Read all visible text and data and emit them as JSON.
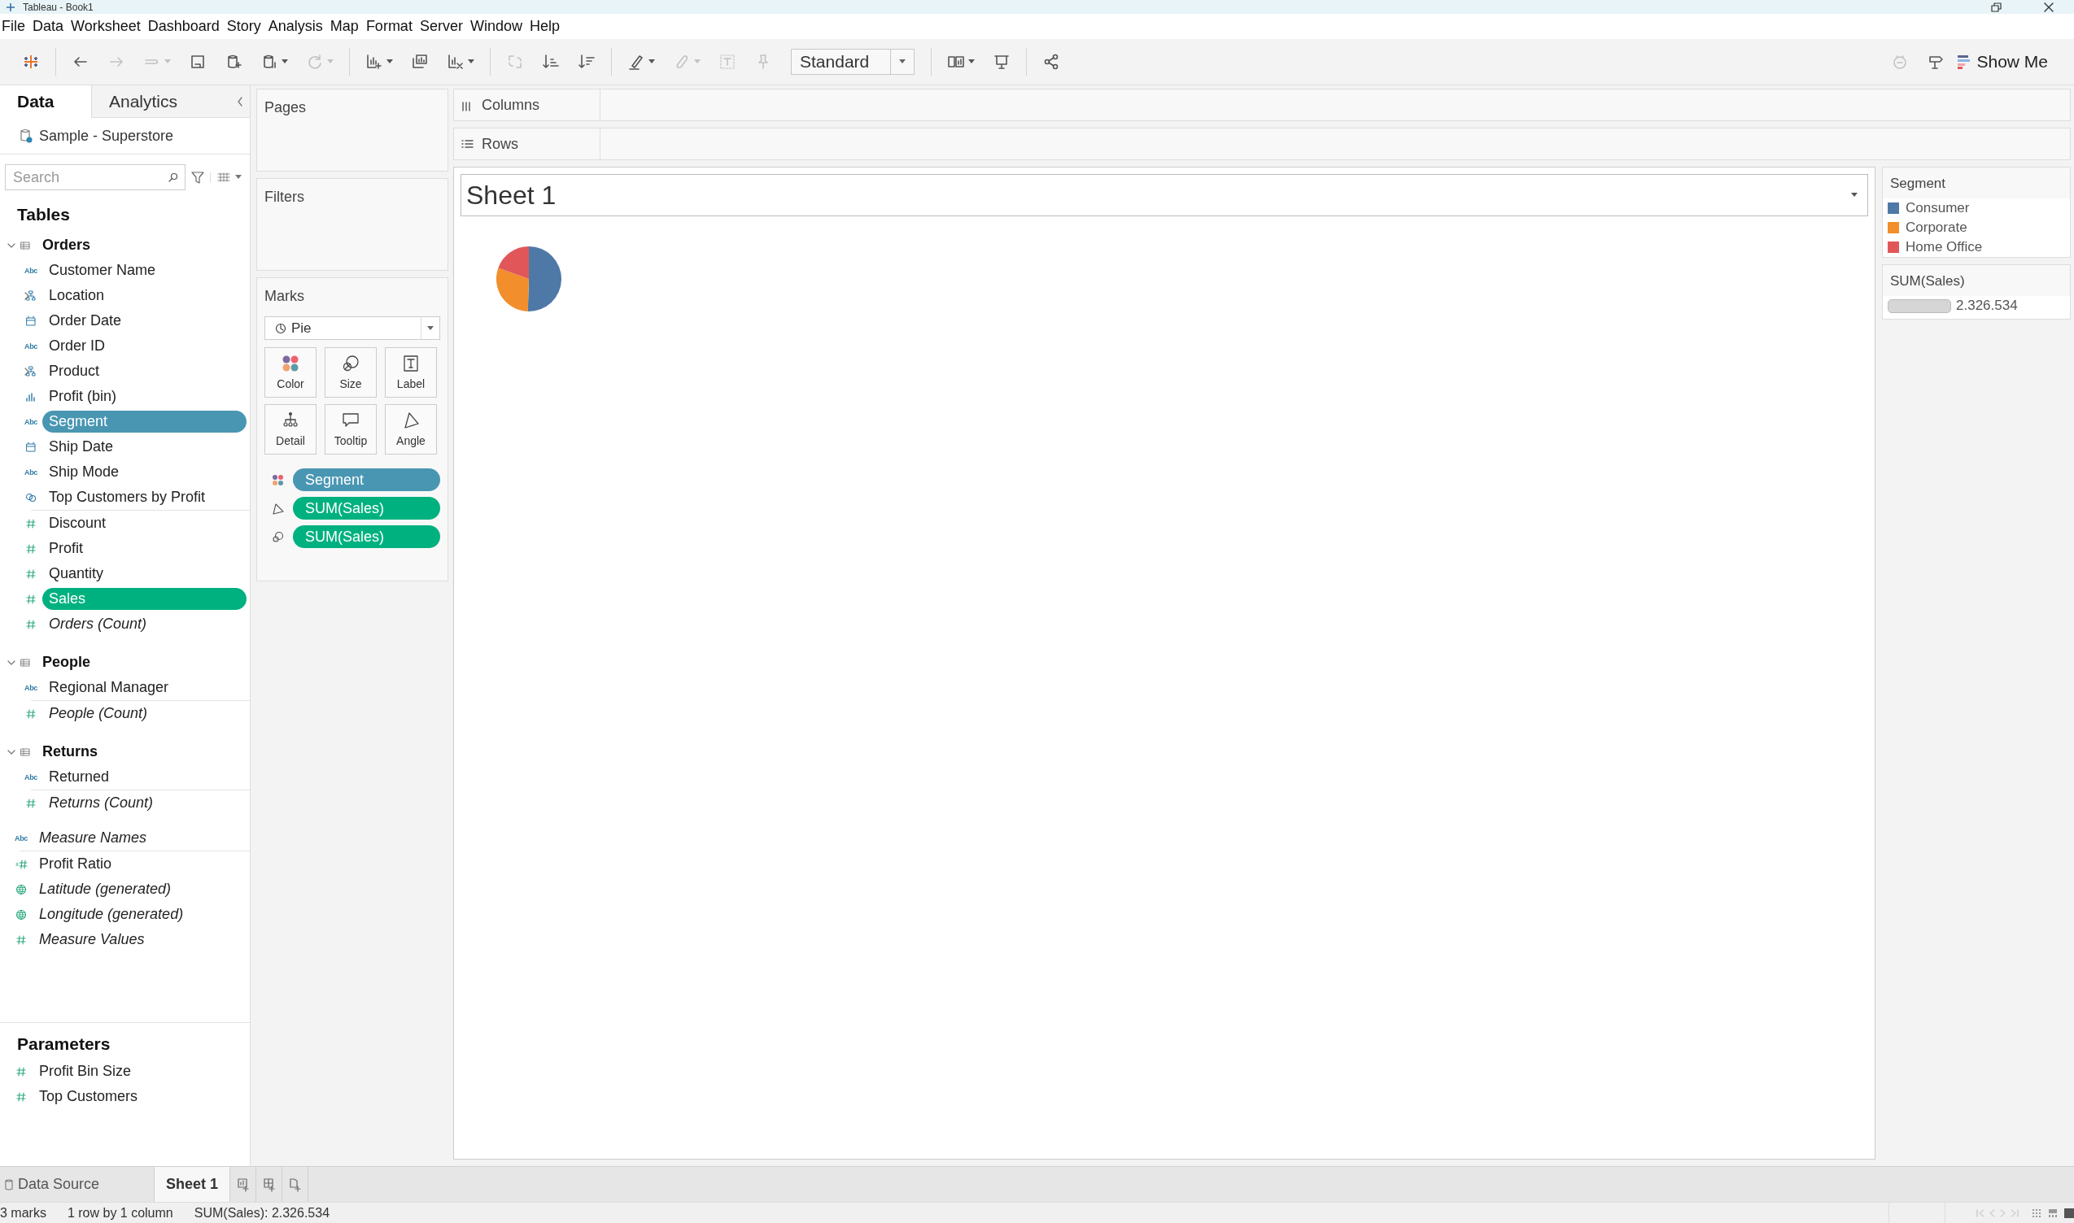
{
  "window": {
    "title": "Tableau - Book1"
  },
  "menu": [
    "File",
    "Data",
    "Worksheet",
    "Dashboard",
    "Story",
    "Analysis",
    "Map",
    "Format",
    "Server",
    "Window",
    "Help"
  ],
  "toolbar": {
    "buttons": [
      {
        "kind": "logo",
        "dropdown": false
      },
      {
        "kind": "separator"
      },
      {
        "kind": "undo",
        "disabled": false,
        "dropdown": false
      },
      {
        "kind": "redo",
        "disabled": true,
        "dropdown": false
      },
      {
        "kind": "replay",
        "disabled": true,
        "dropdown": true
      },
      {
        "kind": "save",
        "disabled": false,
        "dropdown": false
      },
      {
        "kind": "new-datasource",
        "disabled": false,
        "dropdown": false
      },
      {
        "kind": "pause",
        "disabled": false,
        "dropdown": true
      },
      {
        "kind": "refresh",
        "disabled": true,
        "dropdown": true
      },
      {
        "kind": "separator"
      },
      {
        "kind": "new-worksheet",
        "disabled": false,
        "dropdown": true
      },
      {
        "kind": "duplicate",
        "disabled": false,
        "dropdown": false
      },
      {
        "kind": "clear",
        "disabled": false,
        "dropdown": true
      },
      {
        "kind": "separator"
      },
      {
        "kind": "swap",
        "disabled": true,
        "dropdown": false
      },
      {
        "kind": "sort-ascending",
        "disabled": false,
        "dropdown": false
      },
      {
        "kind": "sort-descending",
        "disabled": false,
        "dropdown": false
      },
      {
        "kind": "separator"
      },
      {
        "kind": "highlight",
        "disabled": false,
        "dropdown": true
      },
      {
        "kind": "group",
        "disabled": true,
        "dropdown": true
      },
      {
        "kind": "labels",
        "disabled": true,
        "dropdown": false
      },
      {
        "kind": "pin",
        "disabled": true,
        "dropdown": false
      },
      {
        "kind": "select",
        "value": "Standard"
      },
      {
        "kind": "separator"
      },
      {
        "kind": "cards",
        "disabled": false,
        "dropdown": true
      },
      {
        "kind": "presentation",
        "disabled": false,
        "dropdown": false
      },
      {
        "kind": "separator"
      },
      {
        "kind": "share",
        "disabled": false,
        "dropdown": false
      }
    ],
    "right": [
      {
        "kind": "bot",
        "disabled": true
      },
      {
        "kind": "signpost",
        "disabled": false
      }
    ],
    "show_me": "Show Me"
  },
  "data_pane": {
    "tabs": [
      {
        "label": "Data",
        "selected": true
      },
      {
        "label": "Analytics",
        "selected": false
      }
    ],
    "datasource": "Sample - Superstore",
    "search": {
      "placeholder": "Search"
    },
    "tables_heading": "Tables",
    "tables": [
      {
        "name": "Orders",
        "expanded": true,
        "fields": [
          {
            "name": "Customer Name",
            "kind": "text",
            "type_label": "Abc",
            "measure": false,
            "generated": false,
            "selected": false
          },
          {
            "name": "Location",
            "kind": "hierarchy",
            "measure": false,
            "generated": false,
            "selected": false,
            "expanded": false
          },
          {
            "name": "Order Date",
            "kind": "date",
            "measure": false,
            "generated": false,
            "selected": false
          },
          {
            "name": "Order ID",
            "kind": "text",
            "type_label": "Abc",
            "measure": false,
            "generated": false,
            "selected": false
          },
          {
            "name": "Product",
            "kind": "hierarchy",
            "measure": false,
            "generated": false,
            "selected": false,
            "expanded": false
          },
          {
            "name": "Profit (bin)",
            "kind": "bin",
            "measure": false,
            "generated": false,
            "selected": false
          },
          {
            "name": "Segment",
            "kind": "text",
            "type_label": "Abc",
            "measure": false,
            "generated": false,
            "selected": true
          },
          {
            "name": "Ship Date",
            "kind": "date",
            "measure": false,
            "generated": false,
            "selected": false
          },
          {
            "name": "Ship Mode",
            "kind": "text",
            "type_label": "Abc",
            "measure": false,
            "generated": false,
            "selected": false
          },
          {
            "name": "Top Customers by Profit",
            "kind": "set",
            "measure": false,
            "generated": false,
            "selected": false
          },
          {
            "name": "Discount",
            "kind": "number",
            "measure": true,
            "generated": false,
            "selected": false
          },
          {
            "name": "Profit",
            "kind": "number",
            "measure": true,
            "generated": false,
            "selected": false
          },
          {
            "name": "Quantity",
            "kind": "number",
            "measure": true,
            "generated": false,
            "selected": false
          },
          {
            "name": "Sales",
            "kind": "number",
            "measure": true,
            "generated": false,
            "selected": true
          },
          {
            "name": "Orders (Count)",
            "kind": "number",
            "measure": true,
            "generated": true,
            "selected": false
          }
        ]
      },
      {
        "name": "People",
        "expanded": true,
        "fields": [
          {
            "name": "Regional Manager",
            "kind": "text",
            "type_label": "Abc",
            "measure": false,
            "generated": false,
            "selected": false
          },
          {
            "name": "People (Count)",
            "kind": "number",
            "measure": true,
            "generated": true,
            "selected": false
          }
        ]
      },
      {
        "name": "Returns",
        "expanded": true,
        "fields": [
          {
            "name": "Returned",
            "kind": "text",
            "type_label": "Abc",
            "measure": false,
            "generated": false,
            "selected": false
          },
          {
            "name": "Returns (Count)",
            "kind": "number",
            "measure": true,
            "generated": true,
            "selected": false
          }
        ]
      }
    ],
    "other_fields": [
      {
        "name": "Measure Names",
        "kind": "text",
        "type_label": "Abc",
        "measure": false,
        "generated": true,
        "selected": false
      },
      {
        "name": "Profit Ratio",
        "kind": "calc",
        "measure": true,
        "generated": false,
        "selected": false
      },
      {
        "name": "Latitude (generated)",
        "kind": "geo",
        "measure": true,
        "generated": true,
        "selected": false
      },
      {
        "name": "Longitude (generated)",
        "kind": "geo",
        "measure": true,
        "generated": true,
        "selected": false
      },
      {
        "name": "Measure Values",
        "kind": "number",
        "measure": true,
        "generated": true,
        "selected": false
      }
    ],
    "parameters_heading": "Parameters",
    "parameters": [
      {
        "name": "Profit Bin Size",
        "kind": "number"
      },
      {
        "name": "Top Customers",
        "kind": "number"
      }
    ]
  },
  "cards": {
    "pages": {
      "title": "Pages"
    },
    "filters": {
      "title": "Filters"
    },
    "marks": {
      "title": "Marks",
      "mark_type": "Pie",
      "properties": [
        {
          "kind": "color",
          "label": "Color"
        },
        {
          "kind": "size",
          "label": "Size"
        },
        {
          "kind": "label",
          "label": "Label"
        },
        {
          "kind": "detail",
          "label": "Detail"
        },
        {
          "kind": "tooltip",
          "label": "Tooltip"
        },
        {
          "kind": "angle",
          "label": "Angle"
        }
      ],
      "pills": [
        {
          "kind": "color",
          "label": "Segment",
          "measure": false
        },
        {
          "kind": "angle",
          "label": "SUM(Sales)",
          "measure": true
        },
        {
          "kind": "size",
          "label": "SUM(Sales)",
          "measure": true
        }
      ]
    }
  },
  "shelves": [
    {
      "kind": "columns",
      "label": "Columns"
    },
    {
      "kind": "rows",
      "label": "Rows"
    }
  ],
  "view": {
    "title": "Sheet 1"
  },
  "legends": [
    {
      "kind": "color",
      "title": "Segment",
      "items": [
        {
          "label": "Consumer",
          "color": "#4e79a7"
        },
        {
          "label": "Corporate",
          "color": "#f28e2b"
        },
        {
          "label": "Home Office",
          "color": "#e15759"
        }
      ]
    },
    {
      "kind": "size",
      "title": "SUM(Sales)",
      "value": "2.326.534"
    }
  ],
  "sheet_tabs": [
    {
      "kind": "datasource",
      "label": "Data Source",
      "selected": false
    },
    {
      "kind": "sheet",
      "label": "Sheet 1",
      "selected": true
    }
  ],
  "status_bar": [
    "3 marks",
    "1 row by 1 column",
    "SUM(Sales): 2.326.534"
  ]
}
